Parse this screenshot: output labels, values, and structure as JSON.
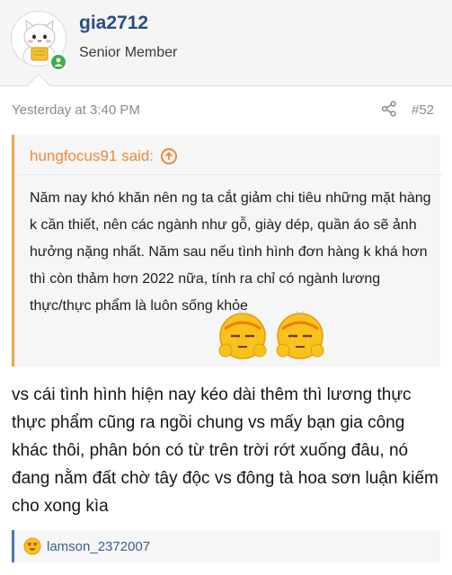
{
  "user": {
    "username": "gia2712",
    "title": "Senior Member"
  },
  "post": {
    "timestamp": "Yesterday at 3:40 PM",
    "post_number": "#52",
    "body": "vs cái tình hình hiện nay kéo dài thêm thì lương thực thực phẩm cũng ra ngồi chung vs mấy bạn gia công khác thôi, phân bón có từ trên trời rớt xuống đâu, nó đang nằm đất chờ tây độc vs đông tà hoa sơn luận kiếm cho xong kìa"
  },
  "quote": {
    "attribution": "hungfocus91 said:",
    "text": "Năm nay khó khăn nên ng ta cắt giảm chi tiêu những mặt hàng k cần thiết, nên các ngành như gỗ, giày dép, quần áo sẽ ảnh hưởng nặng nhất. Năm sau nếu tình hình đơn hàng k khá hơn thì còn thảm hơn 2022 nữa, tính ra chỉ có ngành lương thực/thực phẩm là luôn sống khỏe",
    "emojis": [
      "hot-face-emoji",
      "hot-face-emoji"
    ]
  },
  "reactions": {
    "users": "lamson_2372007",
    "icon": "heart-eyes-emoji"
  },
  "colors": {
    "username": "#2a4d7e",
    "quote_accent": "#ed8a3a",
    "reaction_accent": "#4a74b8",
    "online": "#3fae49"
  }
}
